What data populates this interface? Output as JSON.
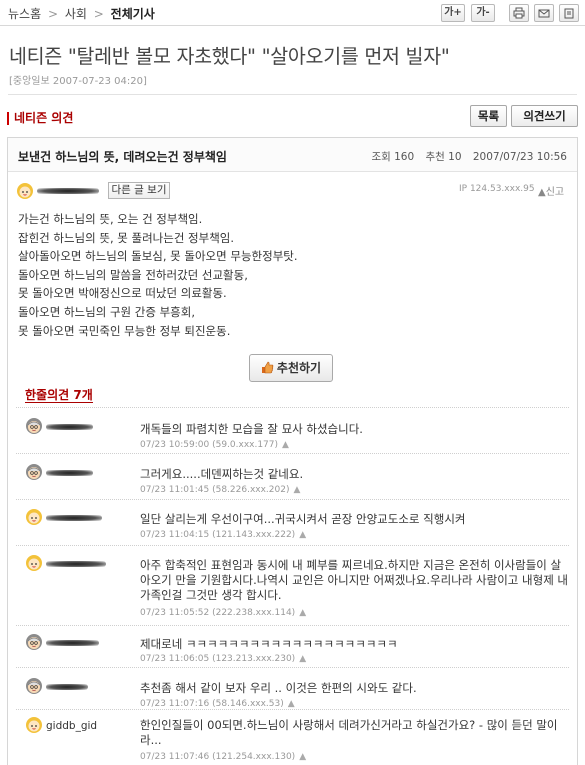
{
  "breadcrumb": {
    "items": [
      "뉴스홈",
      "사회",
      "전체기사"
    ],
    "separator": ">"
  },
  "toolbar": {
    "font_up": "가+",
    "font_down": "가-",
    "icons": [
      "print-icon",
      "mail-icon",
      "clip-icon"
    ]
  },
  "article": {
    "title": "네티즌 \"탈레반 볼모 자초했다\" \"살아오기를 먼저 빌자\"",
    "byline": "[중앙일보 2007-07-23 04:20]"
  },
  "opinion": {
    "section_title": "네티즌 의견",
    "list_button": "목록",
    "write_button": "의견쓰기"
  },
  "post": {
    "title": "보낸건 하느님의 뜻, 데려오는건 정부책임",
    "views_label": "조회 160",
    "recommend_label": "추천 10",
    "date": "2007/07/23 10:56",
    "other_posts_button": "다른 글 보기",
    "ip": "IP 124.53.xxx.95",
    "report": "신고",
    "body_lines": [
      "가는건 하느님의 뜻, 오는 건 정부책임.",
      "잡힌건 하느님의 뜻, 못 풀려나는건 정부책임.",
      "살아돌아오면 하느님의 돌보심, 못 돌아오면 무능한정부탓.",
      "돌아오면 하느님의 말씀을 전하러갔던 선교활동,",
      "못 돌아오면 박애정신으로 떠났던 의료활동.",
      "돌아오면 하느님의 구원 간증 부흥회,",
      "못 돌아오면 국민죽인 무능한 정부 퇴진운동."
    ],
    "recommend_button": "추천하기"
  },
  "comments": {
    "title": "한줄의견 7개",
    "items": [
      {
        "nick": "",
        "nick_hidden": true,
        "avatar": "old-man",
        "text": "개독들의 파렴치한 모습을 잘 묘사 하셨습니다.",
        "meta": "07/23 10:59:00 (59.0.xxx.177)"
      },
      {
        "nick": "",
        "nick_hidden": true,
        "avatar": "old-man",
        "text": "그러게요.....데덴찌하는것 같네요.",
        "meta": "07/23 11:01:45 (58.226.xxx.202)"
      },
      {
        "nick": "",
        "nick_hidden": true,
        "avatar": "girl",
        "text": "일단 살리는게 우선이구여...귀국시켜서 곧장 안양교도소로 직행시켜",
        "meta": "07/23 11:04:15 (121.143.xxx.222)"
      },
      {
        "nick": "",
        "nick_hidden": true,
        "avatar": "girl",
        "text": "아주 합축적인 표현임과 동시에 내 폐부를 찌르네요.하지만 지금은 온전히 이사람들이 살아오기 만을 기원합시다.나역시 교인은 아니지만 어쩌겠나요.우리나라 사람이고 내형제 내가족인걸 그것만 생각 합시다.",
        "meta": "07/23 11:05:52 (222.238.xxx.114)"
      },
      {
        "nick": "",
        "nick_hidden": true,
        "avatar": "old-man",
        "text": "제대로네 ㅋㅋㅋㅋㅋㅋㅋㅋㅋㅋㅋㅋㅋㅋㅋㅋㅋㅋㅋㅋ",
        "meta": "07/23 11:06:05 (123.213.xxx.230)"
      },
      {
        "nick": "",
        "nick_hidden": true,
        "avatar": "old-man",
        "text": "추천좀 해서 같이 보자 우리 .. 이것은 한편의 시와도 같다.",
        "meta": "07/23 11:07:16 (58.146.xxx.53)"
      },
      {
        "nick": "giddb_gid",
        "nick_hidden": false,
        "avatar": "girl",
        "text": "한인인질들이 00되면.하느님이 사랑해서 데려가신거라고 하실건가요? - 많이 듣던 말이라...",
        "meta": "07/23 11:07:46 (121.254.xxx.130)"
      }
    ]
  },
  "colors": {
    "accent_red": "#aa0000",
    "border": "#d6d6d6",
    "meta_gray": "#999999"
  }
}
